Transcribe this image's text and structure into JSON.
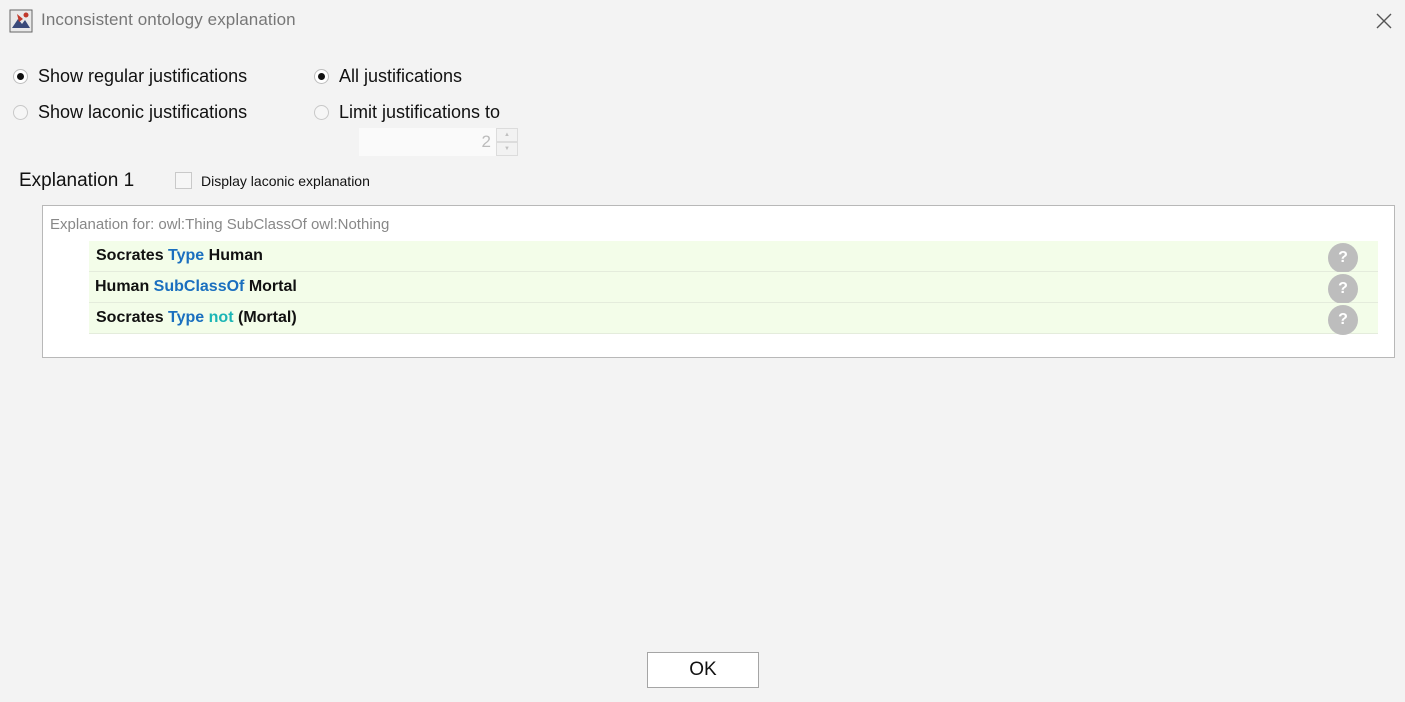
{
  "window": {
    "title": "Inconsistent ontology explanation",
    "icons": {
      "app": "app-icon",
      "close": "close-icon"
    }
  },
  "options": {
    "justification_type": [
      {
        "label": "Show regular justifications",
        "checked": true
      },
      {
        "label": "Show laconic justifications",
        "checked": false
      }
    ],
    "justification_count": [
      {
        "label": "All justifications",
        "checked": true
      },
      {
        "label": "Limit justifications to",
        "checked": false
      }
    ],
    "limit_value": "2"
  },
  "explanation": {
    "title": "Explanation 1",
    "laconic_checkbox": {
      "label": "Display laconic explanation",
      "checked": false
    },
    "header": "Explanation for: owl:Thing SubClassOf owl:Nothing",
    "axioms": [
      {
        "tokens": [
          {
            "text": "Socrates ",
            "kind": "entity"
          },
          {
            "text": "Type ",
            "kind": "kw"
          },
          {
            "text": "Human",
            "kind": "entity"
          }
        ]
      },
      {
        "tokens": [
          {
            "text": "Human ",
            "kind": "entity"
          },
          {
            "text": "SubClassOf ",
            "kind": "kw"
          },
          {
            "text": "Mortal",
            "kind": "entity"
          }
        ]
      },
      {
        "tokens": [
          {
            "text": "Socrates ",
            "kind": "entity"
          },
          {
            "text": "Type ",
            "kind": "kw"
          },
          {
            "text": "not ",
            "kind": "kw-not"
          },
          {
            "text": "(Mortal)",
            "kind": "entity"
          }
        ]
      }
    ],
    "help_label": "?"
  },
  "footer": {
    "ok_label": "OK"
  },
  "colors": {
    "keyword": "#1a6fbf",
    "not_keyword": "#1bb5b5",
    "axiom_row_bg": "#f3fde9"
  }
}
